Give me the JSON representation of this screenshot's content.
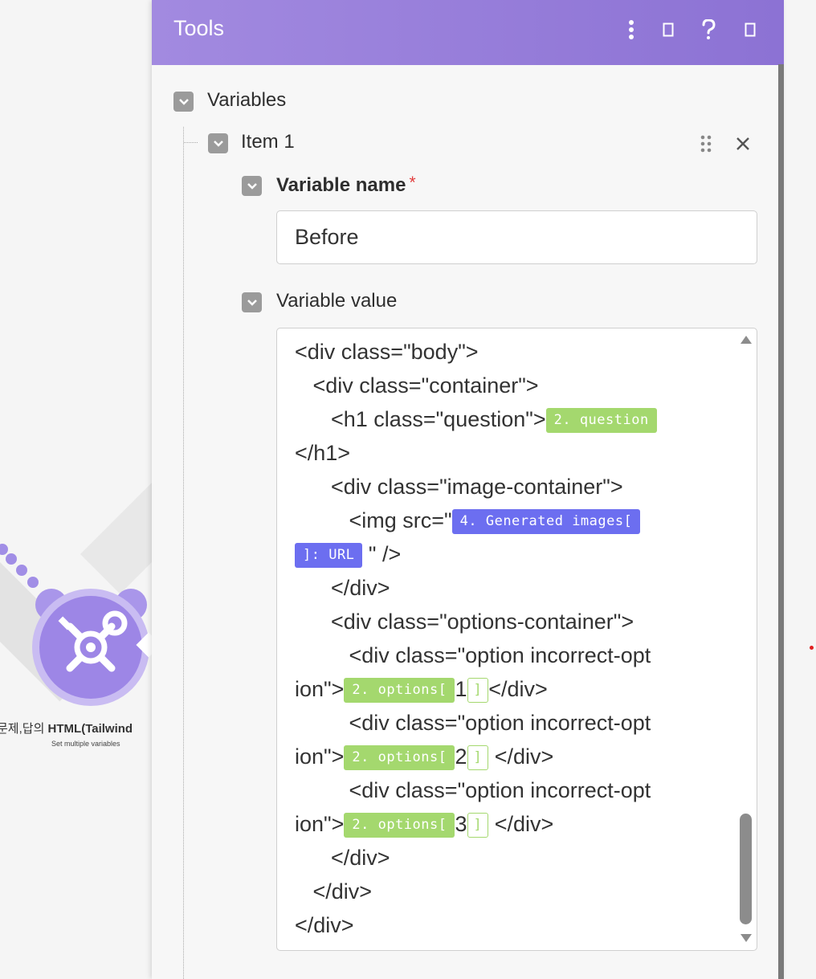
{
  "panel": {
    "title": "Tools",
    "header_buttons": [
      {
        "name": "more-menu-icon"
      },
      {
        "name": "window-icon"
      },
      {
        "name": "help-icon"
      },
      {
        "name": "expand-icon"
      }
    ]
  },
  "form": {
    "variables_label": "Variables",
    "item_label": "Item 1",
    "variable_name_label": "Variable name",
    "required_mark": "*",
    "variable_name_value": "Before",
    "variable_value_label": "Variable value"
  },
  "code": {
    "line1": "<div class=\"body\">",
    "line2": "   <div class=\"container\">",
    "line3_text": "      <h1 class=\"question\">",
    "line3_pill": "2. question",
    "line4": "</h1>",
    "line5": "      <div class=\"image-container\">",
    "line6_text": "         <img src=\"",
    "line6_pill": "4. Generated images[",
    "line7_pill": "]: URL",
    "line7_text": " \" />",
    "line8": "      </div>",
    "line9": "      <div class=\"options-container\">",
    "line10": "         <div class=\"option incorrect-opt",
    "line11_pre": "ion\">",
    "line11_pill": "2. options[",
    "line11_num": "1",
    "line11_close": "]",
    "line11_post": "</div>",
    "line12": "         <div class=\"option incorrect-opt",
    "line13_pre": "ion\">",
    "line13_pill": "2. options[",
    "line13_num": "2",
    "line13_close": "]",
    "line13_post": " </div>",
    "line14": "         <div class=\"option incorrect-opt",
    "line15_pre": "ion\">",
    "line15_pill": "2. options[",
    "line15_num": "3",
    "line15_close": "]",
    "line15_post": " </div>",
    "line16": "      </div>",
    "line17": "   </div>",
    "line18": "</div>"
  },
  "module": {
    "title_prefix": "문제,답의 ",
    "title_bold": "HTML(Tailwind",
    "subtitle": "Set multiple variables"
  },
  "colors": {
    "header_start": "#a28ae0",
    "header_end": "#8c72d4",
    "green_pill": "#a4d86e",
    "blue_pill": "#6c6ef0"
  }
}
